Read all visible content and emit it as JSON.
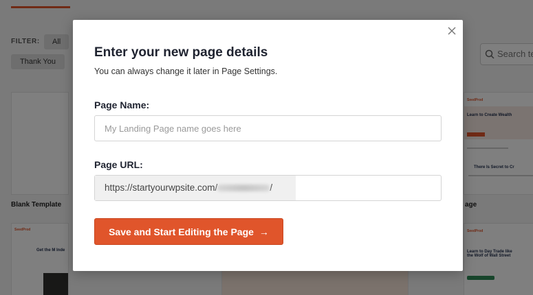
{
  "background": {
    "filter_label": "FILTER:",
    "filter_all": "All",
    "filter_thank_you": "Thank You",
    "search_placeholder": "Search te",
    "blank_template_caption": "Blank Template",
    "right_caption": "age",
    "wealth_card": {
      "logo": "SeedProd",
      "title": "Learn to Create Wealth",
      "subtitle": "There Is Secret to Cr"
    },
    "right2_card": {
      "logo": "SeedProd",
      "title": "Learn to Day Trade like the Wolf of Wall Street"
    },
    "left2_card": {
      "logo": "SeedProd",
      "title": "Get the M Inde"
    }
  },
  "modal": {
    "title": "Enter your new page details",
    "subtitle": "You can always change it later in Page Settings.",
    "page_name_label": "Page Name:",
    "page_name_placeholder": "My Landing Page name goes here",
    "page_name_value": "",
    "page_url_label": "Page URL:",
    "page_url_prefix": "https://startyourwpsite.com/",
    "page_url_suffix": "/",
    "submit_label": "Save and Start Editing the Page",
    "submit_arrow": "→",
    "close_icon": "close-icon",
    "accent_color": "#e0552b"
  }
}
